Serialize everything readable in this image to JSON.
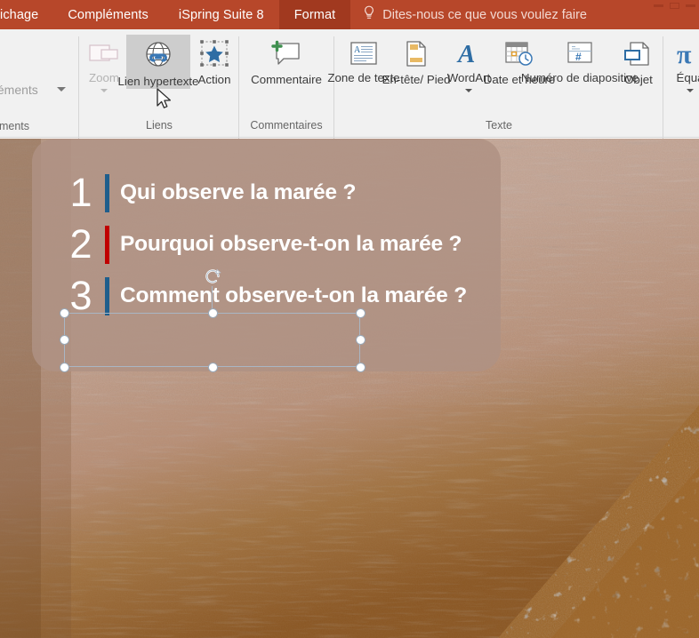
{
  "window": {
    "controls": [
      "minimize-control",
      "restore-control",
      "close-control"
    ]
  },
  "ribbon": {
    "tabs": [
      {
        "label": "ichage",
        "active": false,
        "truncated": true
      },
      {
        "label": "Compléments",
        "active": false
      },
      {
        "label": "iSpring Suite 8",
        "active": false
      },
      {
        "label": "Format",
        "active": true
      }
    ],
    "tell_me": {
      "icon": "lightbulb-icon",
      "label": "Dites-nous ce que vous voulez faire"
    },
    "left_truncated_group": {
      "button_label": "pléments",
      "group_label": "éments",
      "dropdown_icon": "caret-down-icon"
    },
    "groups": [
      {
        "name": "Liens",
        "label": "Liens",
        "buttons": [
          {
            "label": "Zoom",
            "icon": "zoom-slide-icon",
            "state": "disabled",
            "has_dropdown": true
          },
          {
            "label": "Lien hypertexte",
            "icon": "globe-link-icon",
            "state": "hover"
          },
          {
            "label": "Action",
            "icon": "star-action-icon",
            "state": "normal"
          }
        ]
      },
      {
        "name": "Commentaires",
        "label": "Commentaires",
        "buttons": [
          {
            "label": "Commentaire",
            "icon": "new-comment-icon",
            "state": "normal"
          }
        ]
      },
      {
        "name": "Texte",
        "label": "Texte",
        "buttons": [
          {
            "label": "Zone de texte",
            "icon": "text-box-icon",
            "state": "normal"
          },
          {
            "label": "En-tête/ Pied",
            "icon": "header-footer-icon",
            "state": "normal"
          },
          {
            "label": "WordArt",
            "icon": "wordart-icon",
            "state": "normal",
            "has_dropdown": true
          },
          {
            "label": "Date et heure",
            "icon": "date-time-icon",
            "state": "normal"
          },
          {
            "label": "Numéro de diapositive",
            "icon": "slide-number-icon",
            "state": "normal"
          },
          {
            "label": "Objet",
            "icon": "object-icon",
            "state": "normal"
          }
        ]
      },
      {
        "name": "Symboles",
        "label": "",
        "buttons": [
          {
            "label": "Équa",
            "icon": "equation-pi-icon",
            "state": "normal",
            "has_dropdown": true
          }
        ]
      }
    ]
  },
  "slide": {
    "background_description": "beach-sand-tide-photo",
    "colors": {
      "sand_light": "#c4a696",
      "sand_mid": "#b08a6f",
      "wet_sand": "#8c5626",
      "foam": "#cdb7a5",
      "panel": "#af9283"
    },
    "content_panel": {
      "rows": [
        {
          "number": "1",
          "text": "Qui observe la marée ?",
          "bar_color": "#1f5e8c"
        },
        {
          "number": "2",
          "text": "Pourquoi observe-t-on la marée ?",
          "bar_color": "#c00000"
        },
        {
          "number": "3",
          "text": "Comment observe-t-on la marée ?",
          "bar_color": "#1f5e8c"
        }
      ]
    },
    "selection": {
      "target_row": "1",
      "handle_color": "#ffffff",
      "border_color": "#a9b6c4",
      "rotation_icon": "rotate-handle-icon",
      "handles": [
        "top-left",
        "top-center",
        "top-right",
        "middle-left",
        "middle-right",
        "bottom-left",
        "bottom-center",
        "bottom-right"
      ]
    }
  },
  "cursor": {
    "icon": "mouse-pointer-icon"
  }
}
